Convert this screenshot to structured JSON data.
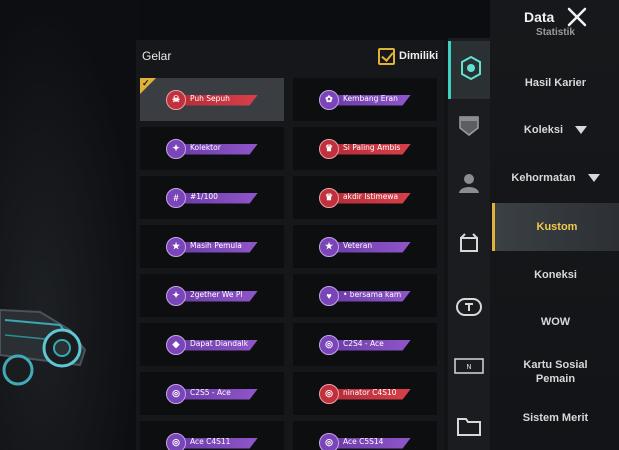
{
  "header": {
    "title": "Data"
  },
  "panel": {
    "title": "Gelar",
    "owned_filter_label": "Dimiliki",
    "owned_filter_checked": true
  },
  "titles": [
    {
      "label": "Puh Sepuh",
      "color": "red",
      "emblem": "skull",
      "selected": true
    },
    {
      "label": "Kembang Eran",
      "color": "purple",
      "emblem": "flower"
    },
    {
      "label": "Kolektor",
      "color": "purple",
      "emblem": "collector"
    },
    {
      "label": "Si Paling Ambis",
      "color": "red",
      "emblem": "crown"
    },
    {
      "label": "#1/100",
      "color": "purple",
      "emblem": "number"
    },
    {
      "label": "akdir Istimewa",
      "color": "red",
      "emblem": "crown"
    },
    {
      "label": "Masih Pemula",
      "color": "purple",
      "emblem": "star"
    },
    {
      "label": "Veteran",
      "color": "purple",
      "emblem": "star"
    },
    {
      "label": "2gether We Pl",
      "color": "purple",
      "emblem": "duo"
    },
    {
      "label": "• bersama kam",
      "color": "purple",
      "emblem": "group"
    },
    {
      "label": "Dapat Diandalk",
      "color": "purple",
      "emblem": "shield"
    },
    {
      "label": "C2S4 - Ace",
      "color": "purple",
      "emblem": "ace"
    },
    {
      "label": "C2S5 - Ace",
      "color": "purple",
      "emblem": "ace"
    },
    {
      "label": "ninator C4S10",
      "color": "red",
      "emblem": "ace"
    },
    {
      "label": "Ace C4S11",
      "color": "purple",
      "emblem": "ace"
    },
    {
      "label": "Ace C5S14",
      "color": "purple",
      "emblem": "ace"
    }
  ],
  "rail_icons": [
    {
      "name": "title-badge-icon",
      "active": true
    },
    {
      "name": "frame-shield-icon",
      "active": false
    },
    {
      "name": "avatar-person-icon",
      "active": false
    },
    {
      "name": "chest-box-icon",
      "active": false
    },
    {
      "name": "nameplate-icon",
      "active": false
    },
    {
      "name": "name-card-icon",
      "active": false
    },
    {
      "name": "folder-icon",
      "active": false
    }
  ],
  "menu": {
    "partial_top": "Statistik",
    "items": [
      {
        "label": "Hasil Karier"
      },
      {
        "label": "Koleksi",
        "has_caret": true
      },
      {
        "label": "Kehormatan",
        "has_caret": true
      },
      {
        "label": "Kustom",
        "active": true
      },
      {
        "label": "Koneksi"
      },
      {
        "label": "WOW"
      },
      {
        "label": "Kartu Sosial Pemain"
      },
      {
        "label": "Sistem Merit"
      }
    ]
  },
  "colors": {
    "accent_gold": "#e0b23a",
    "accent_teal": "#3fd0c2",
    "badge_red": "#c0303d",
    "badge_purple": "#7a45b8"
  }
}
